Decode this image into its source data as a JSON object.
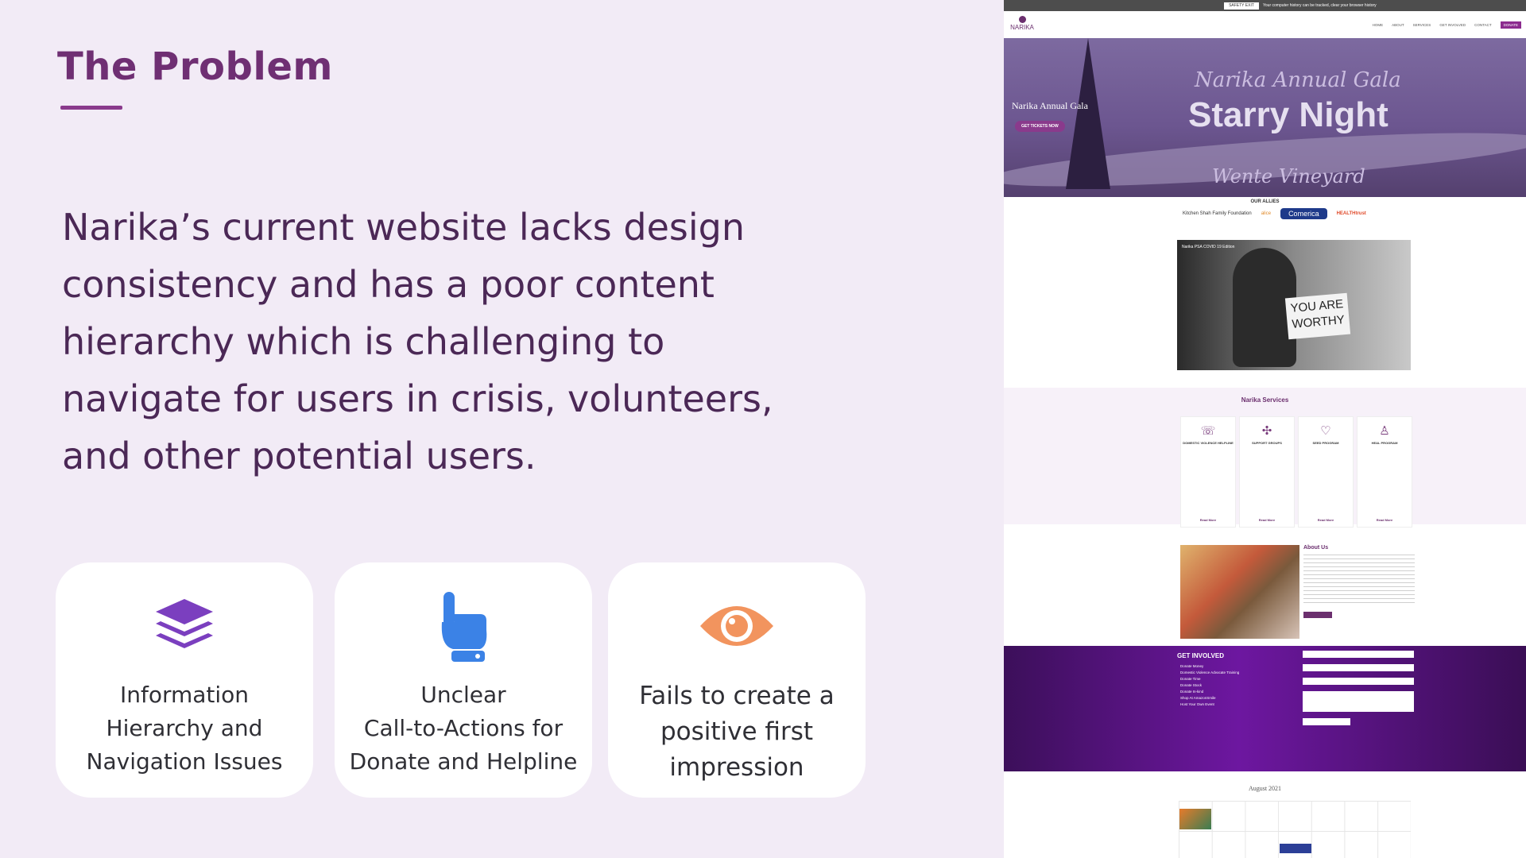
{
  "slide": {
    "title": "The Problem",
    "body": "Narika’s current website lacks design consistency and has a poor content hierarchy which is challenging to navigate for users in crisis, volunteers, and other potential users."
  },
  "cards": [
    {
      "label": "Information\nHierarchy and\nNavigation Issues",
      "icon": "layers-icon",
      "color": "#7b3fbf"
    },
    {
      "label": "Unclear\nCall-to-Actions for\nDonate and Helpline",
      "icon": "pointer-hand-icon",
      "color": "#3b82e6"
    },
    {
      "label": "Fails to create a\npositive first\nimpression",
      "icon": "eye-icon",
      "color": "#f2945e"
    }
  ],
  "website": {
    "safety_exit": "SAFETY EXIT",
    "alert_text": "Your computer history can be tracked, clear your browser history",
    "logo": "NARIKA",
    "nav": [
      "HOME",
      "ABOUT",
      "SERVICES",
      "GET INVOLVED",
      "CONTACT"
    ],
    "nav_donate": "DONATE",
    "hero_script": "Narika Annual Gala",
    "hero_big": "Starry Night",
    "hero_venue": "Wente Vineyard",
    "hero_side": "Narika Annual Gala",
    "hero_cta": "GET TICKETS NOW",
    "allies_title": "OUR ALLIES",
    "allies": [
      "Kitchen Shah Family Foundation",
      "alice",
      "Comerica",
      "HEALTHtrust"
    ],
    "video_title": "Narika PSA COVID 19 Edition",
    "video_sign": "YOU ARE WORTHY",
    "services_title": "Narika Services",
    "services": [
      "DOMESTIC VIOLENCE HELPLINE",
      "SUPPORT GROUPS",
      "SEED PROGRAM",
      "HEAL PROGRAM"
    ],
    "read_more": "Read More",
    "about_title": "About Us",
    "involved_title": "GET INVOLVED",
    "involved_items": [
      "Donate Money",
      "Domestic Violence Advocate Training",
      "Donate Time",
      "Donate Stock",
      "Donate In-kind",
      "Shop At AmazonSmile",
      "Host Your Own Event"
    ],
    "calendar_title": "August 2021"
  }
}
